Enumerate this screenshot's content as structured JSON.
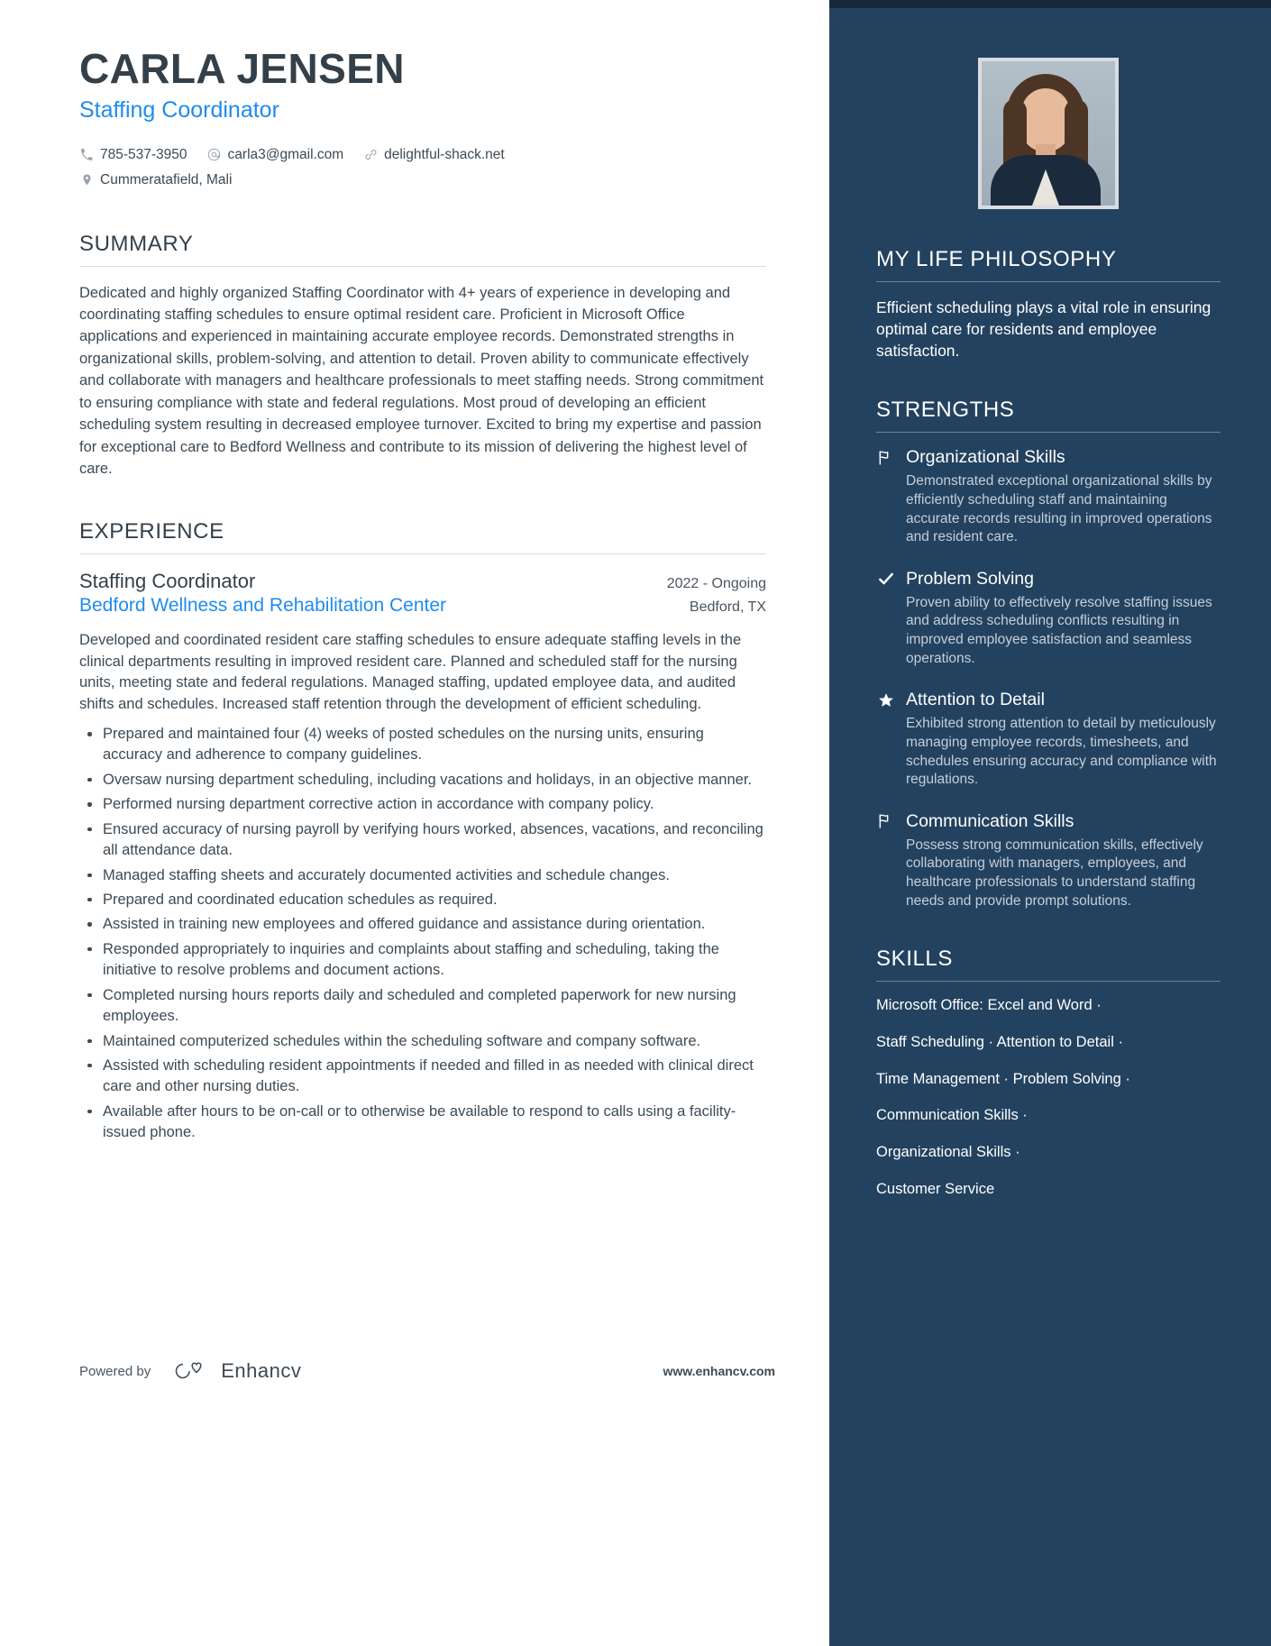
{
  "header": {
    "name": "CARLA JENSEN",
    "role": "Staffing Coordinator",
    "contacts": [
      {
        "icon": "phone-icon",
        "value": "785-537-3950"
      },
      {
        "icon": "email-icon",
        "value": "carla3@gmail.com"
      },
      {
        "icon": "link-icon",
        "value": "delightful-shack.net"
      }
    ],
    "location": {
      "icon": "location-pin-icon",
      "value": "Cummeratafield, Mali"
    }
  },
  "summary": {
    "title": "SUMMARY",
    "text": "Dedicated and highly organized Staffing Coordinator with 4+ years of experience in developing and coordinating staffing schedules to ensure optimal resident care. Proficient in Microsoft Office applications and experienced in maintaining accurate employee records. Demonstrated strengths in organizational skills, problem-solving, and attention to detail. Proven ability to communicate effectively and collaborate with managers and healthcare professionals to meet staffing needs. Strong commitment to ensuring compliance with state and federal regulations. Most proud of developing an efficient scheduling system resulting in decreased employee turnover. Excited to bring my expertise and passion for exceptional care to Bedford Wellness and contribute to its mission of delivering the highest level of care."
  },
  "experience": {
    "title": "EXPERIENCE",
    "jobs": [
      {
        "title": "Staffing Coordinator",
        "dates": "2022 - Ongoing",
        "company": "Bedford Wellness and Rehabilitation Center",
        "location": "Bedford, TX",
        "description": "Developed and coordinated resident care staffing schedules to ensure adequate staffing levels in the clinical departments resulting in improved resident care. Planned and scheduled staff for the nursing units, meeting state and federal regulations. Managed staffing, updated employee data, and audited shifts and schedules. Increased staff retention through the development of efficient scheduling.",
        "bullets": [
          "Prepared and maintained four (4) weeks of posted schedules on the nursing units, ensuring accuracy and adherence to company guidelines.",
          "Oversaw nursing department scheduling, including vacations and holidays, in an objective manner.",
          "Performed nursing department corrective action in accordance with company policy.",
          "Ensured accuracy of nursing payroll by verifying hours worked, absences, vacations, and reconciling all attendance data.",
          "Managed staffing sheets and accurately documented activities and schedule changes.",
          "Prepared and coordinated education schedules as required.",
          "Assisted in training new employees and offered guidance and assistance during orientation.",
          "Responded appropriately to inquiries and complaints about staffing and scheduling, taking the initiative to resolve problems and document actions.",
          "Completed nursing hours reports daily and scheduled and completed paperwork for new nursing employees.",
          "Maintained computerized schedules within the scheduling software and company software.",
          "Assisted with scheduling resident appointments if needed and filled in as needed with clinical direct care and other nursing duties.",
          "Available after hours to be on-call or to otherwise be available to respond to calls using a facility-issued phone."
        ]
      }
    ]
  },
  "footer": {
    "powered_by": "Powered by",
    "brand": "Enhancv",
    "url": "www.enhancv.com"
  },
  "sidebar": {
    "philosophy": {
      "title": "MY LIFE PHILOSOPHY",
      "text": "Efficient scheduling plays a vital role in ensuring optimal care for residents and employee satisfaction."
    },
    "strengths": {
      "title": "STRENGTHS",
      "items": [
        {
          "icon": "flag-icon",
          "title": "Organizational Skills",
          "text": "Demonstrated exceptional organizational skills by efficiently scheduling staff and maintaining accurate records resulting in improved operations and resident care."
        },
        {
          "icon": "check-icon",
          "title": "Problem Solving",
          "text": "Proven ability to effectively resolve staffing issues and address scheduling conflicts resulting in improved employee satisfaction and seamless operations."
        },
        {
          "icon": "star-icon",
          "title": "Attention to Detail",
          "text": "Exhibited strong attention to detail by meticulously managing employee records, timesheets, and schedules ensuring accuracy and compliance with regulations."
        },
        {
          "icon": "flag-icon",
          "title": "Communication Skills",
          "text": "Possess strong communication skills, effectively collaborating with managers, employees, and healthcare professionals to understand staffing needs and provide prompt solutions."
        }
      ]
    },
    "skills": {
      "title": "SKILLS",
      "lines": [
        "Microsoft Office: Excel and Word ·",
        "Staff Scheduling · Attention to Detail ·",
        "Time Management · Problem Solving ·",
        "Communication Skills ·",
        "Organizational Skills ·",
        "Customer Service"
      ]
    },
    "photo_alt": "profile-photo"
  },
  "colors": {
    "accent_blue": "#1f8ceb",
    "sidebar_bg": "#23425f",
    "topbar": "#16293c",
    "text": "#33404a"
  }
}
